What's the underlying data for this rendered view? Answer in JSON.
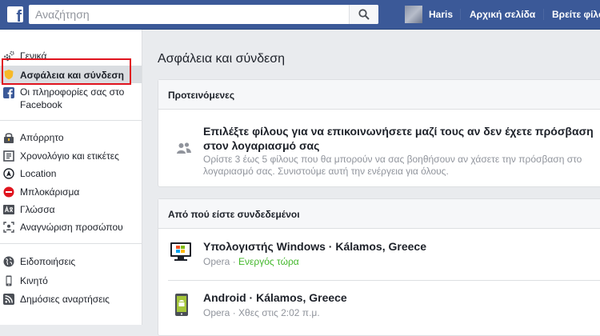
{
  "topbar": {
    "logo": "f",
    "search_placeholder": "Αναζήτηση",
    "user_name": "Haris",
    "home_label": "Αρχική σελίδα",
    "find_friends_label": "Βρείτε φίλους"
  },
  "sidebar": {
    "items": [
      {
        "label": "Γενικά",
        "icon": "gear-icon"
      },
      {
        "label": "Ασφάλεια και σύνδεση",
        "icon": "shield-icon",
        "active": true
      },
      {
        "label": "Οι πληροφορίες σας στο Facebook",
        "icon": "facebook-icon"
      },
      {
        "label": "Απόρρητο",
        "icon": "lock-icon"
      },
      {
        "label": "Χρονολόγιο και ετικέτες",
        "icon": "timeline-icon"
      },
      {
        "label": "Location",
        "icon": "location-icon"
      },
      {
        "label": "Μπλοκάρισμα",
        "icon": "block-icon"
      },
      {
        "label": "Γλώσσα",
        "icon": "language-icon"
      },
      {
        "label": "Αναγνώριση προσώπου",
        "icon": "face-recognition-icon"
      },
      {
        "label": "Ειδοποιήσεις",
        "icon": "globe-icon"
      },
      {
        "label": "Κινητό",
        "icon": "mobile-icon"
      },
      {
        "label": "Δημόσιες αναρτήσεις",
        "icon": "rss-icon"
      }
    ],
    "info_line1": "Οι πληροφορίες σας στο",
    "info_line2": "Facebook"
  },
  "main": {
    "title": "Ασφάλεια και σύνδεση",
    "recommended": {
      "header": "Προτεινόμενες",
      "title": "Επιλέξτε φίλους για να επικοινωνήσετε μαζί τους αν δεν έχετε πρόσβαση στον λογαριασμό σας",
      "description": "Ορίστε 3 έως 5 φίλους που θα μπορούν να σας βοηθήσουν αν χάσετε την πρόσβαση στο λογαριασμό σας. Συνιστούμε αυτή την ενέργεια για όλους."
    },
    "sessions": {
      "header": "Από πού είστε συνδεδεμένοι",
      "items": [
        {
          "device": "Υπολογιστής Windows · Kálamos, Greece",
          "browser": "Opera",
          "status": "Ενεργός τώρα",
          "icon": "windows-desktop-icon"
        },
        {
          "device": "Android · Kálamos, Greece",
          "browser": "Opera",
          "status": "Χθες στις 2:02 π.μ.",
          "icon": "android-phone-icon"
        }
      ]
    }
  },
  "colors": {
    "brand": "#3b5998",
    "active_green": "#42b72a",
    "highlight_red": "#e0141e"
  }
}
